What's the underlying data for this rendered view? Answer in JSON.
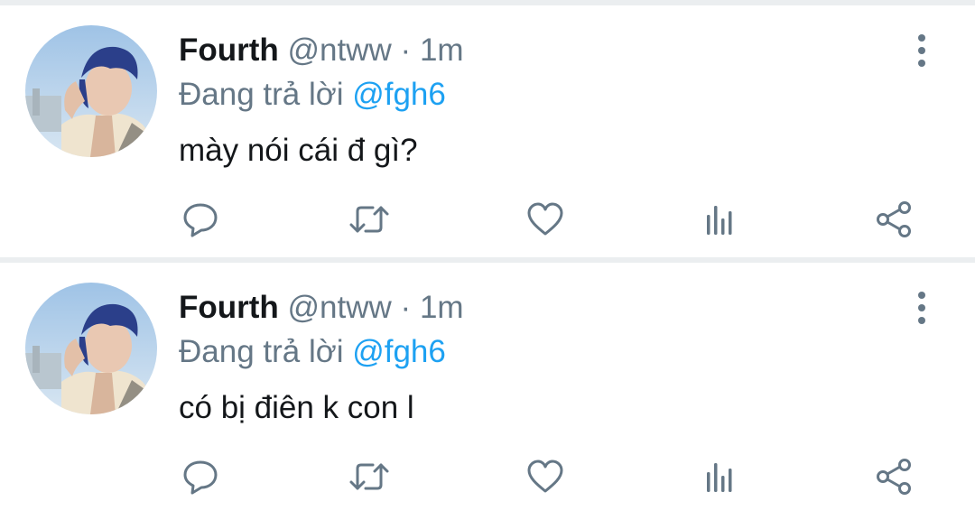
{
  "tweets": [
    {
      "name": "Fourth",
      "handle": "@ntww",
      "separator": "·",
      "time": "1m",
      "reply_prefix": "Đang trả lời",
      "reply_to": "@fgh6",
      "text": "mày nói cái đ gì?"
    },
    {
      "name": "Fourth",
      "handle": "@ntww",
      "separator": "·",
      "time": "1m",
      "reply_prefix": "Đang trả lời",
      "reply_to": "@fgh6",
      "text": "có bị điên k con l"
    }
  ],
  "icons": {
    "reply": "comment-icon",
    "retweet": "retweet-icon",
    "like": "heart-icon",
    "stats": "analytics-icon",
    "share": "share-icon",
    "more": "more-vertical-icon"
  },
  "colors": {
    "name": "#14171a",
    "secondary": "#657786",
    "mention": "#1da1f2",
    "divider": "#ebeef0"
  }
}
